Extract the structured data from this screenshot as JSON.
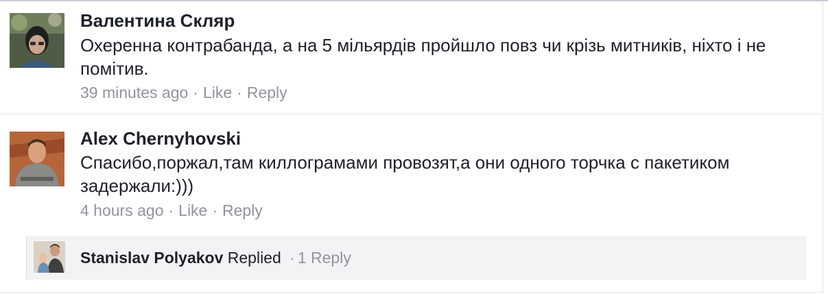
{
  "comments": [
    {
      "author": "Валентина Скляр",
      "text": "Охеренна контрабанда, а на 5 мільярдів пройшло повз чи крізь митників, ніхто і не помітив.",
      "time": "39 minutes ago",
      "like_label": "Like",
      "reply_label": "Reply"
    },
    {
      "author": "Alex  Chernyhovski",
      "text": "Спасибо,поржал,там киллограмами провозят,а они одного торчка с пакетиком задержали:)))",
      "time": "4 hours ago",
      "like_label": "Like",
      "reply_label": "Reply"
    }
  ],
  "reply_summary": {
    "name": "Stanislav Polyakov",
    "action": "Replied",
    "count_label": "1 Reply"
  },
  "separator": "·",
  "colors": {
    "text": "#1d2129",
    "meta": "#90949c",
    "reply_bg": "#f2f3f5",
    "divider": "#e5e6e9"
  }
}
